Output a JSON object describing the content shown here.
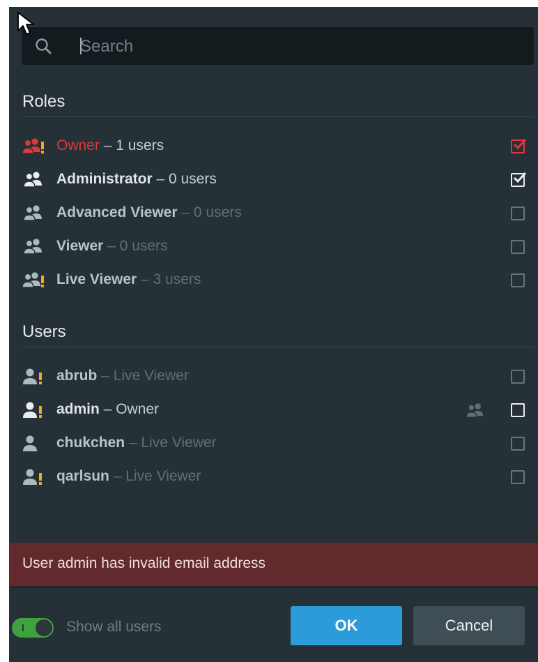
{
  "search": {
    "placeholder": "Search"
  },
  "roles": {
    "title": "Roles",
    "items": [
      {
        "name": "Owner",
        "meta": " – 1 users",
        "icon": "group-warning-icon",
        "checked": true,
        "style": "owner"
      },
      {
        "name": "Administrator",
        "meta": " – 0 users",
        "icon": "group-icon",
        "checked": true,
        "style": "normal"
      },
      {
        "name": "Advanced Viewer",
        "meta": " – 0 users",
        "icon": "group-icon",
        "checked": false,
        "style": "normal"
      },
      {
        "name": "Viewer",
        "meta": " – 0 users",
        "icon": "group-icon",
        "checked": false,
        "style": "normal"
      },
      {
        "name": "Live Viewer",
        "meta": " – 3 users",
        "icon": "group-warning-icon",
        "checked": false,
        "style": "normal"
      }
    ]
  },
  "users": {
    "title": "Users",
    "items": [
      {
        "name": "abrub",
        "meta": " – Live Viewer",
        "icon": "user-warning-icon",
        "checked": false
      },
      {
        "name": "admin",
        "meta": " – Owner",
        "icon": "user-warning-icon",
        "checked": false
      },
      {
        "name": "chukchen",
        "meta": " – Live Viewer",
        "icon": "user-icon",
        "checked": false
      },
      {
        "name": "qarlsun",
        "meta": " – Live Viewer",
        "icon": "user-warning-icon",
        "checked": false
      }
    ]
  },
  "error": {
    "message": "User admin has invalid email address"
  },
  "footer": {
    "show_all_label": "Show all users",
    "ok_label": "OK",
    "cancel_label": "Cancel"
  },
  "colors": {
    "accent": "#2b9bd9",
    "owner_red": "#e0373b",
    "warning": "#f5a623",
    "error_bg": "#632a2d",
    "toggle_on": "#3ea33e"
  }
}
